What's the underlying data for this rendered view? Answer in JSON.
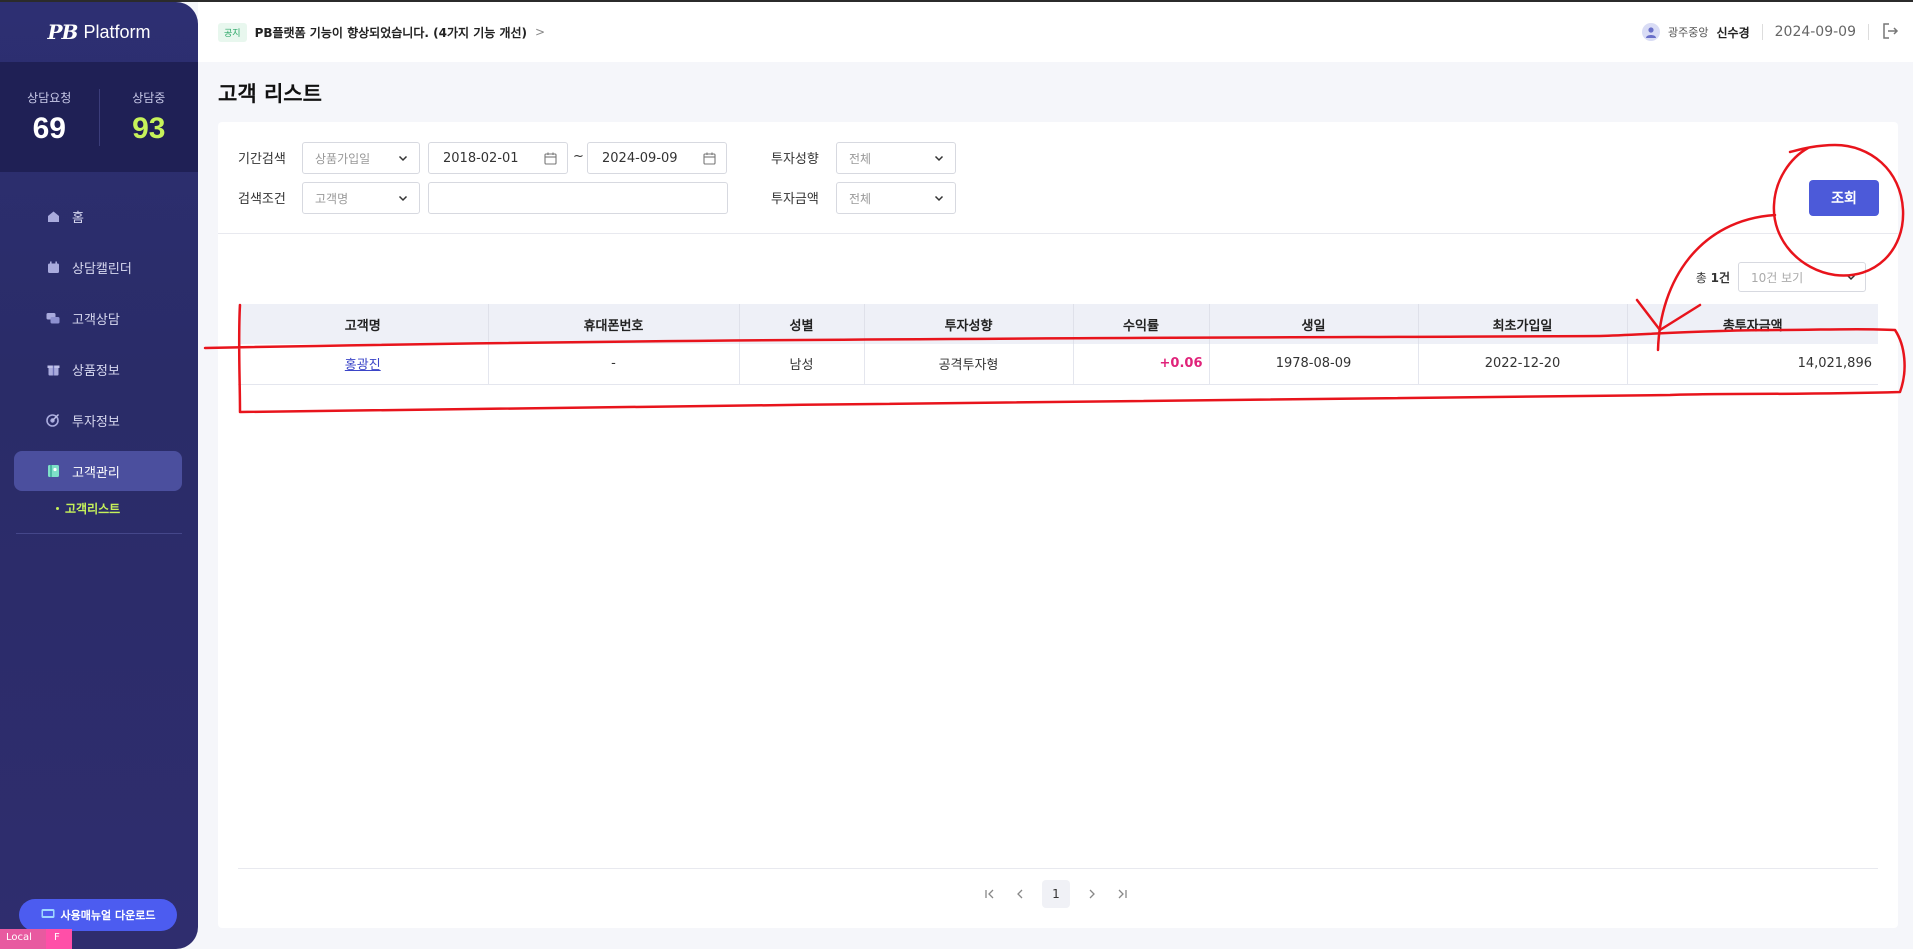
{
  "brand": {
    "logo_mark": "PB",
    "logo_text": "Platform"
  },
  "stats": [
    {
      "label": "상담요청",
      "value": "69"
    },
    {
      "label": "상담중",
      "value": "93"
    }
  ],
  "nav": {
    "items": [
      {
        "label": "홈",
        "icon": "home-icon"
      },
      {
        "label": "상담캘린더",
        "icon": "calendar-icon"
      },
      {
        "label": "고객상담",
        "icon": "chat-icon"
      },
      {
        "label": "상품정보",
        "icon": "gift-icon"
      },
      {
        "label": "투자정보",
        "icon": "target-icon"
      },
      {
        "label": "고객관리",
        "icon": "customer-book-icon"
      }
    ],
    "sub_item": "고객리스트",
    "manual_button": "사용매뉴얼 다운로드"
  },
  "env": {
    "local": "Local",
    "flag": "F"
  },
  "header": {
    "notice_tag": "공지",
    "notice_text": "PB플랫폼 기능이 향상되었습니다. (4가지 기능 개선)",
    "notice_arrow": ">",
    "user_branch": "광주중앙",
    "user_name": "신수경",
    "date": "2024-09-09"
  },
  "page": {
    "title": "고객 리스트"
  },
  "filters": {
    "period_label": "기간검색",
    "period_type": "상품가입일",
    "date_from": "2018-02-01",
    "date_sep": "~",
    "date_to": "2024-09-09",
    "invest_style_label": "투자성향",
    "invest_style_value": "전체",
    "search_label": "검색조건",
    "search_type": "고객명",
    "search_value": "",
    "invest_amount_label": "투자금액",
    "invest_amount_value": "전체",
    "search_button": "조회"
  },
  "results": {
    "total_prefix": "총",
    "total_count": "1건",
    "page_size": "10건 보기"
  },
  "table": {
    "columns": [
      "고객명",
      "휴대폰번호",
      "성별",
      "투자성향",
      "수익률",
      "생일",
      "최초가입일",
      "총투자금액"
    ],
    "rows": [
      {
        "name": "홍광진",
        "phone": "-",
        "gender": "남성",
        "style": "공격투자형",
        "return": "+0.06",
        "birthday": "1978-08-09",
        "joined": "2022-12-20",
        "total": "14,021,896"
      }
    ]
  },
  "pagination": {
    "current": "1"
  },
  "colors": {
    "sidebar": "#2d2f72",
    "accent": "#4c5ad9",
    "highlight": "#c6f25a",
    "annotation": "#e8141c"
  }
}
